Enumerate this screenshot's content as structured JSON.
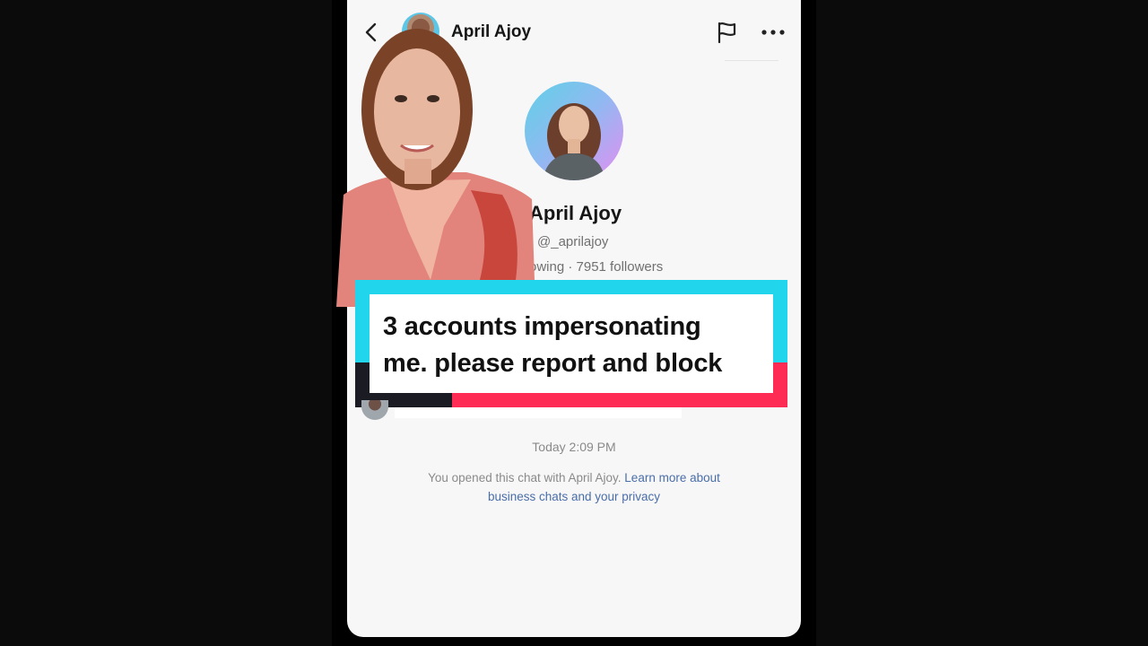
{
  "header": {
    "name": "April Ajoy",
    "back_icon": "chevron-left-icon",
    "flag_icon": "flag-icon",
    "more_icon": "more-horizontal-icon"
  },
  "profile": {
    "name": "April Ajoy",
    "handle": "@_aprilajoy",
    "stats": "owing · 7951 followers"
  },
  "caption": {
    "line1": "3 accounts impersonating",
    "line2": "me. please report and block",
    "colors": {
      "cyan": "#20d5ec",
      "red": "#fe2c55",
      "dark": "#1b1b23"
    }
  },
  "chat": {
    "timestamp": "Today 2:09 PM",
    "notice_text": "You opened this chat with April Ajoy.",
    "notice_link": "Learn more about business chats and your privacy"
  }
}
